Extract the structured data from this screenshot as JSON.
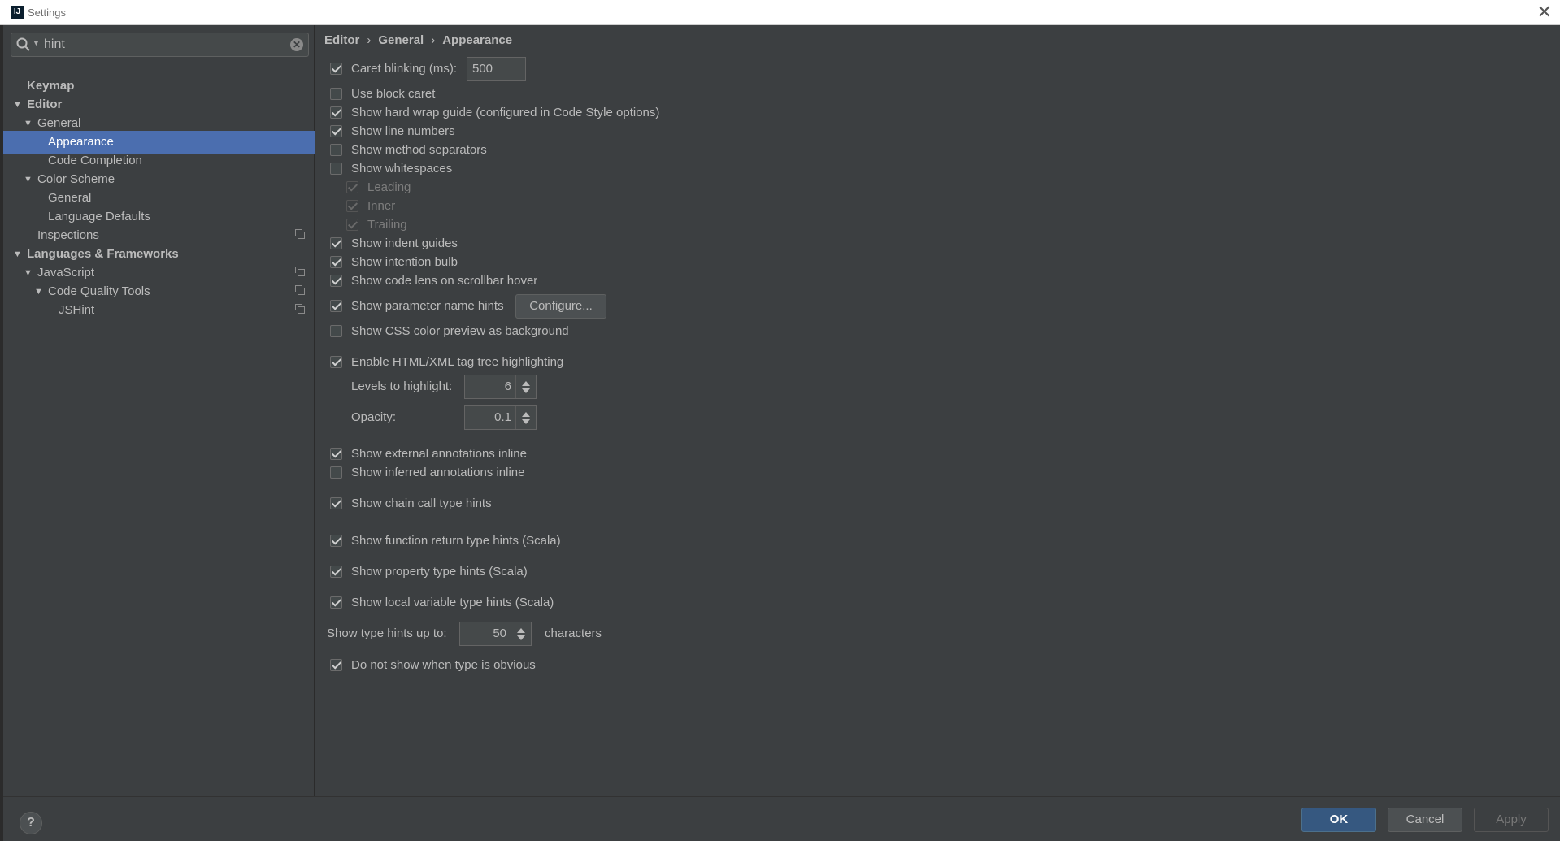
{
  "window": {
    "title": "Settings",
    "app_icon": "IJ",
    "close_glyph": "✕"
  },
  "search": {
    "value": "hint",
    "clear_glyph": "✕"
  },
  "tree": [
    {
      "label": "Keymap"
    },
    {
      "label": "Editor"
    },
    {
      "label": "General"
    },
    {
      "label": "Appearance"
    },
    {
      "label": "Code Completion"
    },
    {
      "label": "Color Scheme"
    },
    {
      "label": "General"
    },
    {
      "label": "Language Defaults"
    },
    {
      "label": "Inspections"
    },
    {
      "label": "Languages & Frameworks"
    },
    {
      "label": "JavaScript"
    },
    {
      "label": "Code Quality Tools"
    },
    {
      "label": "JSHint"
    }
  ],
  "breadcrumb": [
    "Editor",
    "General",
    "Appearance"
  ],
  "breadcrumb_separator": "›",
  "options": {
    "caret_blinking": {
      "label": "Caret blinking (ms):",
      "value": "500"
    },
    "block_caret": "Use block caret",
    "hard_wrap": "Show hard wrap guide (configured in Code Style options)",
    "line_numbers": "Show line numbers",
    "method_separators": "Show method separators",
    "whitespaces": "Show whitespaces",
    "leading": "Leading",
    "inner": "Inner",
    "trailing": "Trailing",
    "indent_guides": "Show indent guides",
    "intention_bulb": "Show intention bulb",
    "code_lens": "Show code lens on scrollbar hover",
    "param_hints": "Show parameter name hints",
    "configure_button": "Configure...",
    "css_color": "Show CSS color preview as background",
    "tag_tree": "Enable HTML/XML tag tree highlighting",
    "levels": {
      "label": "Levels to highlight:",
      "value": "6"
    },
    "opacity": {
      "label": "Opacity:",
      "value": "0.1"
    },
    "external_annotations": "Show external annotations inline",
    "inferred_annotations": "Show inferred annotations inline",
    "chain_call": "Show chain call type hints",
    "function_return": "Show function return type hints (Scala)",
    "property_type": "Show property type hints (Scala)",
    "local_variable": "Show local variable type hints (Scala)",
    "type_hints_up_to": {
      "label": "Show type hints up to:",
      "value": "50",
      "suffix": "characters"
    },
    "obvious": "Do not show when type is obvious"
  },
  "footer": {
    "help": "?",
    "ok": "OK",
    "cancel": "Cancel",
    "apply": "Apply"
  },
  "colors": {
    "background": "#3c3f41",
    "selection": "#4b6eaf",
    "ok_button": "#365880"
  }
}
